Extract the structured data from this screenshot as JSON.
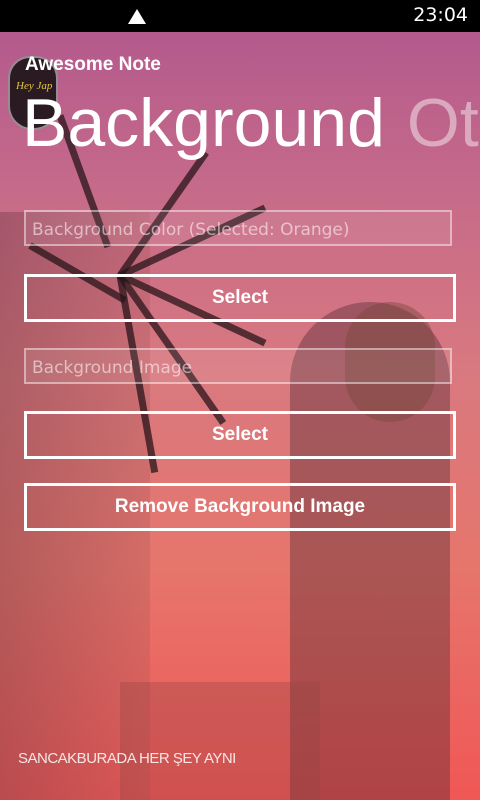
{
  "status_bar": {
    "time": "23:04",
    "signal_icon": "signal-triangle-icon"
  },
  "app": {
    "title": "Awesome Note"
  },
  "pivot": {
    "active": "Background",
    "next": "Ot"
  },
  "background_color": {
    "placeholder": "Background Color (Selected: Orange)"
  },
  "select_color_button": {
    "label": "Select"
  },
  "background_image": {
    "placeholder": "Background Image"
  },
  "select_image_button": {
    "label": "Select"
  },
  "remove_button": {
    "label": "Remove Background Image"
  },
  "wallpaper": {
    "logo_text": "Hey Jap",
    "caption": "SANCAKBURADA HER ŞEY AYNI"
  },
  "colors": {
    "gradient_top": "#b45a8c",
    "gradient_bottom": "#f05755",
    "text": "#ffffff"
  }
}
